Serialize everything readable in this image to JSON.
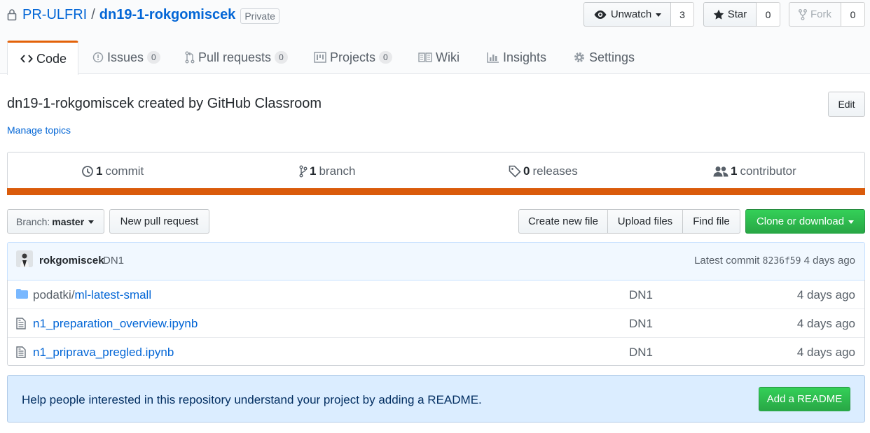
{
  "repo": {
    "owner": "PR-ULFRI",
    "separator": "/",
    "name": "dn19-1-rokgomiscek",
    "visibility": "Private"
  },
  "actions": {
    "watch": {
      "label": "Unwatch",
      "count": "3"
    },
    "star": {
      "label": "Star",
      "count": "0"
    },
    "fork": {
      "label": "Fork",
      "count": "0"
    }
  },
  "tabs": [
    {
      "label": "Code",
      "icon": "code-icon",
      "counter": null
    },
    {
      "label": "Issues",
      "icon": "issue-icon",
      "counter": "0"
    },
    {
      "label": "Pull requests",
      "icon": "pull-request-icon",
      "counter": "0"
    },
    {
      "label": "Projects",
      "icon": "project-icon",
      "counter": "0"
    },
    {
      "label": "Wiki",
      "icon": "book-icon",
      "counter": null
    },
    {
      "label": "Insights",
      "icon": "graph-icon",
      "counter": null
    },
    {
      "label": "Settings",
      "icon": "gear-icon",
      "counter": null
    }
  ],
  "description": "dn19-1-rokgomiscek created by GitHub Classroom",
  "edit_label": "Edit",
  "manage_topics": "Manage topics",
  "stats": {
    "commits": {
      "count": "1",
      "label": "commit"
    },
    "branches": {
      "count": "1",
      "label": "branch"
    },
    "releases": {
      "count": "0",
      "label": "releases"
    },
    "contributors": {
      "count": "1",
      "label": "contributor"
    },
    "language_color": "#da5b0b"
  },
  "file_nav": {
    "branch_prefix": "Branch:",
    "branch_name": "master",
    "new_pull_request": "New pull request",
    "create_new_file": "Create new file",
    "upload_files": "Upload files",
    "find_file": "Find file",
    "clone_or_download": "Clone or download"
  },
  "latest_commit": {
    "author": "rokgomiscek",
    "message": "DN1",
    "prefix": "Latest commit",
    "sha": "8236f59",
    "age": "4 days ago"
  },
  "files": [
    {
      "type": "directory",
      "dir": "podatki/",
      "name": "ml-latest-small",
      "message": "DN1",
      "age": "4 days ago"
    },
    {
      "type": "file",
      "dir": "",
      "name": "n1_preparation_overview.ipynb",
      "message": "DN1",
      "age": "4 days ago"
    },
    {
      "type": "file",
      "dir": "",
      "name": "n1_priprava_pregled.ipynb",
      "message": "DN1",
      "age": "4 days ago"
    }
  ],
  "readme_prompt": {
    "text": "Help people interested in this repository understand your project by adding a README.",
    "button": "Add a README"
  }
}
